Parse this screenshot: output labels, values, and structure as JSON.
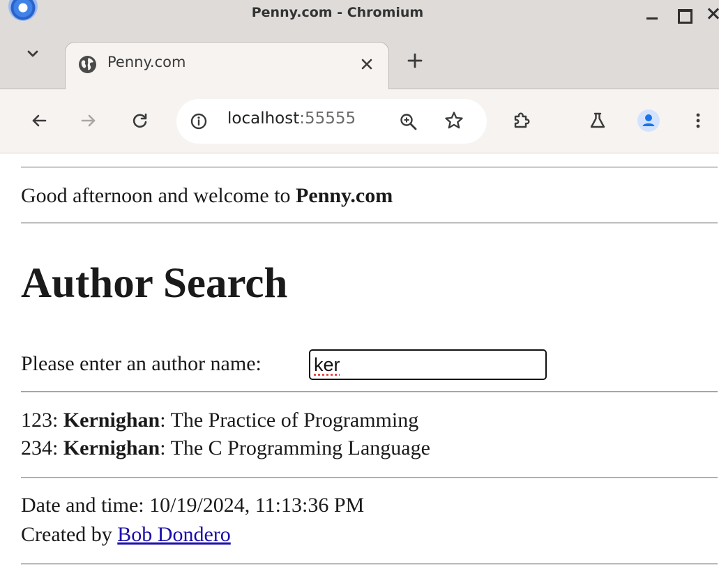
{
  "window": {
    "title": "Penny.com - Chromium"
  },
  "tabs": [
    {
      "title": "Penny.com"
    }
  ],
  "address_bar": {
    "host": "localhost",
    "port": ":55555"
  },
  "page": {
    "greeting": {
      "prefix": "Good afternoon and welcome to ",
      "site": "Penny.com"
    },
    "heading": "Author Search",
    "search": {
      "label": "Please enter an author name: ",
      "value": "ker"
    },
    "results": [
      {
        "id": "123: ",
        "author": "Kernighan",
        "title": ": The Practice of Programming"
      },
      {
        "id": "234: ",
        "author": "Kernighan",
        "title": ": The C Programming Language"
      }
    ],
    "footer": {
      "datetime_label": "Date and time: ",
      "datetime_value": "10/19/2024, 11:13:36 PM",
      "created_label": "Created by ",
      "author_link": "Bob Dondero"
    }
  },
  "colors": {
    "titlebar": "#dedbd9",
    "toolbar": "#f6f3f1",
    "link": "#1a0dab",
    "profile": "#1a73e8",
    "profile_bg": "#d3e3fd"
  },
  "icons": {
    "app": "chromium-logo-icon",
    "tab_search": "chevron-down-icon",
    "favicon": "globe-icon",
    "tab_close": "close-icon",
    "new_tab": "plus-icon",
    "back": "back-arrow-icon",
    "forward": "forward-arrow-icon",
    "reload": "reload-icon",
    "site_info": "info-icon",
    "zoom": "zoom-icon",
    "bookmark": "star-icon",
    "extensions": "puzzle-icon",
    "labs": "flask-icon",
    "profile": "profile-icon",
    "menu": "kebab-menu-icon"
  }
}
